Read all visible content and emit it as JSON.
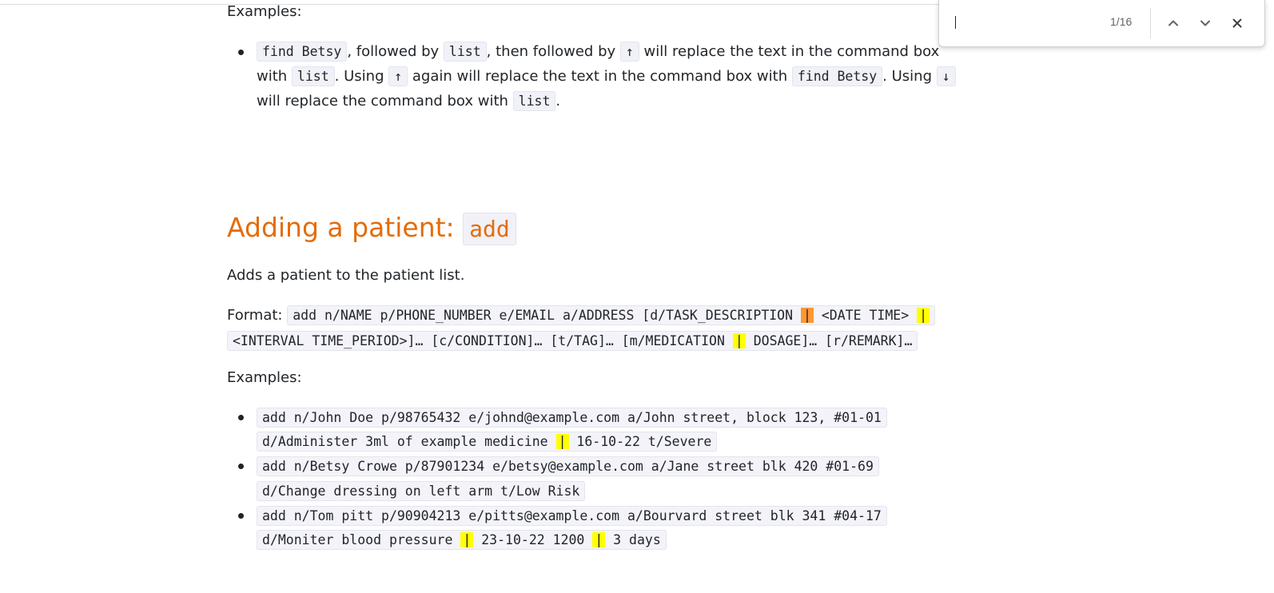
{
  "find_bar": {
    "query": "",
    "match_count": "1/16",
    "icons": [
      "chevron-up-icon",
      "chevron-down-icon",
      "close-icon"
    ]
  },
  "history_section": {
    "examples_label": "Examples:",
    "bullet1": {
      "code_find_betsy": "find Betsy",
      "t_followed_by": ", followed by ",
      "code_list": "list",
      "t_then_followed": ", then followed by ",
      "arrow_up": "↑",
      "t_will_replace": " will replace the text in the command box",
      "t_with": "with ",
      "code_list2": "list",
      "t_using": ". Using ",
      "arrow_up2": "↑",
      "t_again": " again will replace the text in the command box with ",
      "code_find_betsy2": "find Betsy",
      "t_using2": ". Using ",
      "arrow_down": "↓",
      "t_will_replace2": "will replace the command box with ",
      "code_list3": "list",
      "t_period": "."
    }
  },
  "add_section": {
    "heading_text": "Adding a patient: ",
    "heading_code": "add",
    "description": "Adds a patient to the patient list.",
    "format_label": "Format: ",
    "format_line1_a": "add n/NAME p/PHONE_NUMBER e/EMAIL a/ADDRESS [d/TASK_DESCRIPTION ",
    "format_sep1": "|",
    "format_line1_b": " <DATE TIME> ",
    "format_sep2": "|",
    "format_line2_a": "<INTERVAL TIME_PERIOD>]… [c/CONDITION]… [t/TAG]… [m/MEDICATION ",
    "format_sep3": "|",
    "format_line2_b": " DOSAGE]… [r/REMARK]…",
    "examples_label": "Examples:",
    "example1_line1": "add n/John Doe p/98765432 e/johnd@example.com a/John street, block 123, #01-01",
    "example1_line2_a": "d/Administer 3ml of example medicine ",
    "example1_sep": "|",
    "example1_line2_b": " 16-10-22 t/Severe",
    "example2_line1": "add n/Betsy Crowe p/87901234 e/betsy@example.com a/Jane street blk 420 #01-69",
    "example2_line2": "d/Change dressing on left arm t/Low Risk",
    "example3_line1": "add n/Tom pitt p/90904213 e/pitts@example.com a/Bourvard street blk 341 #04-17",
    "example3_line2_a": "d/Moniter blood pressure ",
    "example3_sep1": "|",
    "example3_line2_b": " 23-10-22 1200 ",
    "example3_sep2": "|",
    "example3_line2_c": " 3 days"
  },
  "colors": {
    "heading": "#e46c0a",
    "highlight": "#ffff00",
    "current_highlight": "#ff9632",
    "code_bg": "#f1f1f8"
  }
}
